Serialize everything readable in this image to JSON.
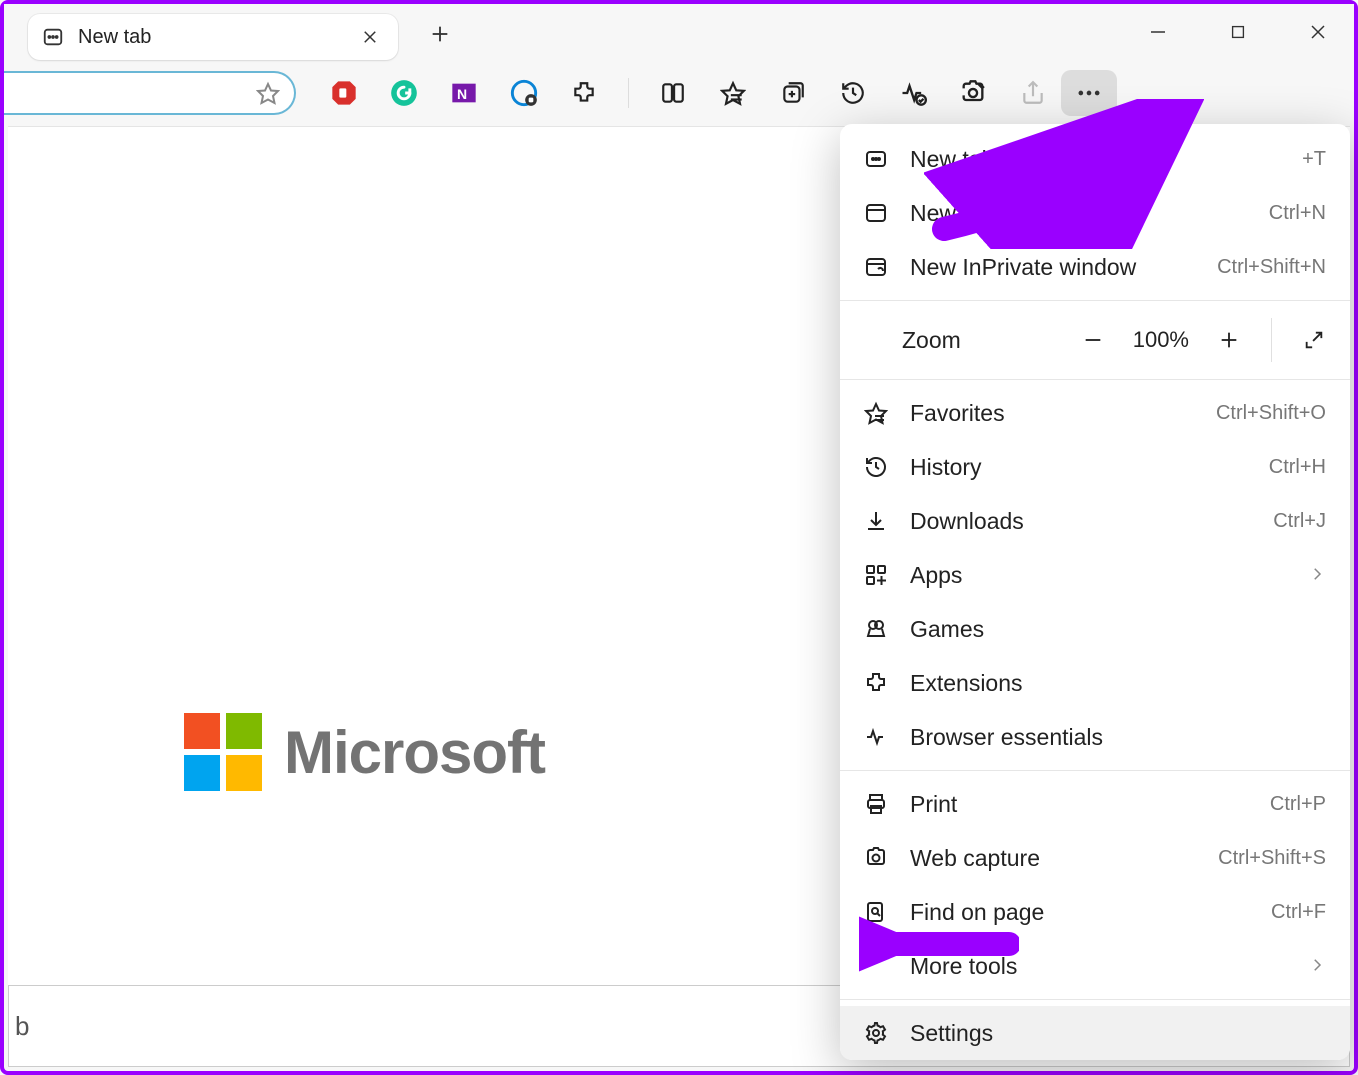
{
  "tab": {
    "title": "New tab"
  },
  "window_controls": {
    "minimize": "Minimize",
    "maximize": "Maximize",
    "close": "Close"
  },
  "toolbar_icons": {
    "adblock": "adblock-icon",
    "grammarly": "grammarly-icon",
    "onenote": "onenote-icon",
    "idm": "download-manager-icon",
    "extensions": "extensions-icon",
    "split": "split-screen-icon",
    "favorites": "favorites-icon",
    "collections": "collections-icon",
    "history": "history-icon",
    "performance": "browser-essentials-icon",
    "capture": "web-capture-icon",
    "share": "share-icon",
    "more": "more-icon"
  },
  "page": {
    "logo_text": "Microsoft",
    "bottom_char": "b"
  },
  "menu": {
    "items": [
      {
        "icon": "new-tab-icon",
        "label": "New tab",
        "shortcut": "+T"
      },
      {
        "icon": "new-window-icon",
        "label": "New window",
        "shortcut": "Ctrl+N"
      },
      {
        "icon": "inprivate-icon",
        "label": "New InPrivate window",
        "shortcut": "Ctrl+Shift+N"
      }
    ],
    "zoom": {
      "label": "Zoom",
      "value": "100%"
    },
    "items2": [
      {
        "icon": "star-icon",
        "label": "Favorites",
        "shortcut": "Ctrl+Shift+O"
      },
      {
        "icon": "history-icon",
        "label": "History",
        "shortcut": "Ctrl+H"
      },
      {
        "icon": "download-icon",
        "label": "Downloads",
        "shortcut": "Ctrl+J"
      },
      {
        "icon": "apps-icon",
        "label": "Apps",
        "chevron": true
      },
      {
        "icon": "games-icon",
        "label": "Games"
      },
      {
        "icon": "extensions-icon",
        "label": "Extensions"
      },
      {
        "icon": "essentials-icon",
        "label": "Browser essentials"
      }
    ],
    "items3": [
      {
        "icon": "print-icon",
        "label": "Print",
        "shortcut": "Ctrl+P"
      },
      {
        "icon": "capture-icon",
        "label": "Web capture",
        "shortcut": "Ctrl+Shift+S"
      },
      {
        "icon": "find-icon",
        "label": "Find on page",
        "shortcut": "Ctrl+F"
      },
      {
        "icon": "",
        "label": "More tools",
        "chevron": true
      }
    ],
    "items4": [
      {
        "icon": "settings-icon",
        "label": "Settings",
        "hover": true
      }
    ]
  },
  "colors": {
    "ms_red": "#f25022",
    "ms_green": "#7fba00",
    "ms_blue": "#00a4ef",
    "ms_yellow": "#ffb900",
    "annotation": "#9a00ff"
  }
}
